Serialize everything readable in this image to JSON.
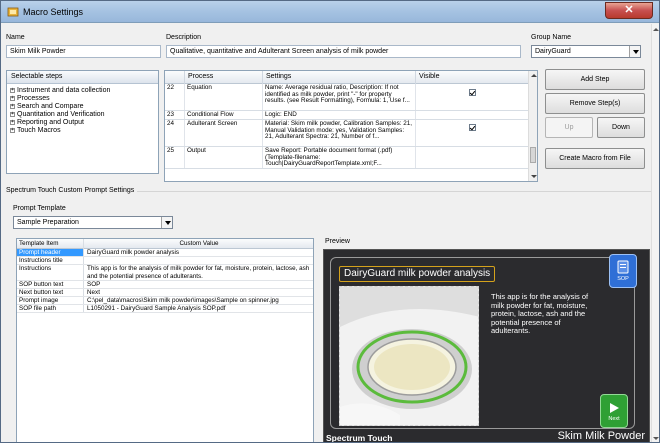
{
  "window": {
    "title": "Macro Settings",
    "close_symbol": "✕"
  },
  "name": {
    "label": "Name",
    "value": "Skim Milk Powder"
  },
  "description": {
    "label": "Description",
    "value": "Qualitative, quantitative and Adulterant Screen analysis of milk powder"
  },
  "group_name": {
    "label": "Group Name",
    "value": "DairyGuard"
  },
  "selectable_steps": {
    "header": "Selectable steps",
    "items": [
      "Instrument and data collection",
      "Processes",
      "Search and Compare",
      "Quantitation and Verification",
      "Reporting and Output",
      "Touch Macros"
    ]
  },
  "steps_grid": {
    "columns": [
      "Process",
      "Settings",
      "Visible"
    ],
    "rows": [
      {
        "num": "22",
        "process": "Equation",
        "settings": "Name: Average residual ratio, Description: If not identified as milk powder, print \"-\" for property results. (see Result Formatting), Formula: 1, Use f...",
        "visible": true
      },
      {
        "num": "23",
        "process": "Conditional Flow",
        "settings": "Logic: END",
        "visible": false
      },
      {
        "num": "24",
        "process": "Adulterant Screen",
        "settings": "Material: Skim milk powder, Calibration Samples: 21, Manual Validation mode: yes, Validation Samples: 21, Adulterant Spectra: 21, Number of f...",
        "visible": true
      },
      {
        "num": "25",
        "process": "Output",
        "settings": "Save Report: Portable document format (.pdf) (Template-filename: Touch|DairyGuardReportTemplate.xml;F...",
        "visible": false
      }
    ]
  },
  "buttons": {
    "add_step": "Add Step",
    "remove_steps": "Remove Step(s)",
    "up": "Up",
    "down": "Down",
    "create_macro": "Create Macro from File"
  },
  "touch_settings": {
    "section_label": "Spectrum Touch Custom Prompt Settings",
    "prompt_template_label": "Prompt Template",
    "prompt_template_value": "Sample Preparation"
  },
  "template_table": {
    "columns": [
      "Template Item",
      "Custom Value"
    ],
    "rows": [
      {
        "item": "Prompt header",
        "value": "DairyGuard milk powder analysis",
        "selected": true
      },
      {
        "item": "Instructions title",
        "value": ""
      },
      {
        "item": "Instructions",
        "value": "This app is for the analysis of milk powder for fat, moisture, protein, lactose, ash and the potential presence of adulterants."
      },
      {
        "item": "SOP button text",
        "value": "SOP"
      },
      {
        "item": "Next button text",
        "value": "Next"
      },
      {
        "item": "Prompt image",
        "value": "C:\\pel_data\\macros\\Skim milk powder\\images\\Sample on spinner.jpg"
      },
      {
        "item": "SOP file path",
        "value": "L1050291 - DairyGuard Sample Analysis SOP.pdf"
      }
    ]
  },
  "preview": {
    "label": "Preview",
    "title": "DairyGuard milk powder analysis",
    "body": "This app is for the analysis of milk powder for fat, moisture, protein, lactose, ash and the potential presence of adulterants.",
    "sop_label": "SOP",
    "next_label": "Next",
    "footer_left": "Spectrum Touch",
    "footer_right": "Skim Milk Powder"
  },
  "colors": {
    "selection": "#3399ff",
    "preview_bg": "#2b2b2e",
    "sop_blue": "#2f6fd6",
    "next_green": "#2fa034",
    "title_border": "#d4a21c"
  }
}
